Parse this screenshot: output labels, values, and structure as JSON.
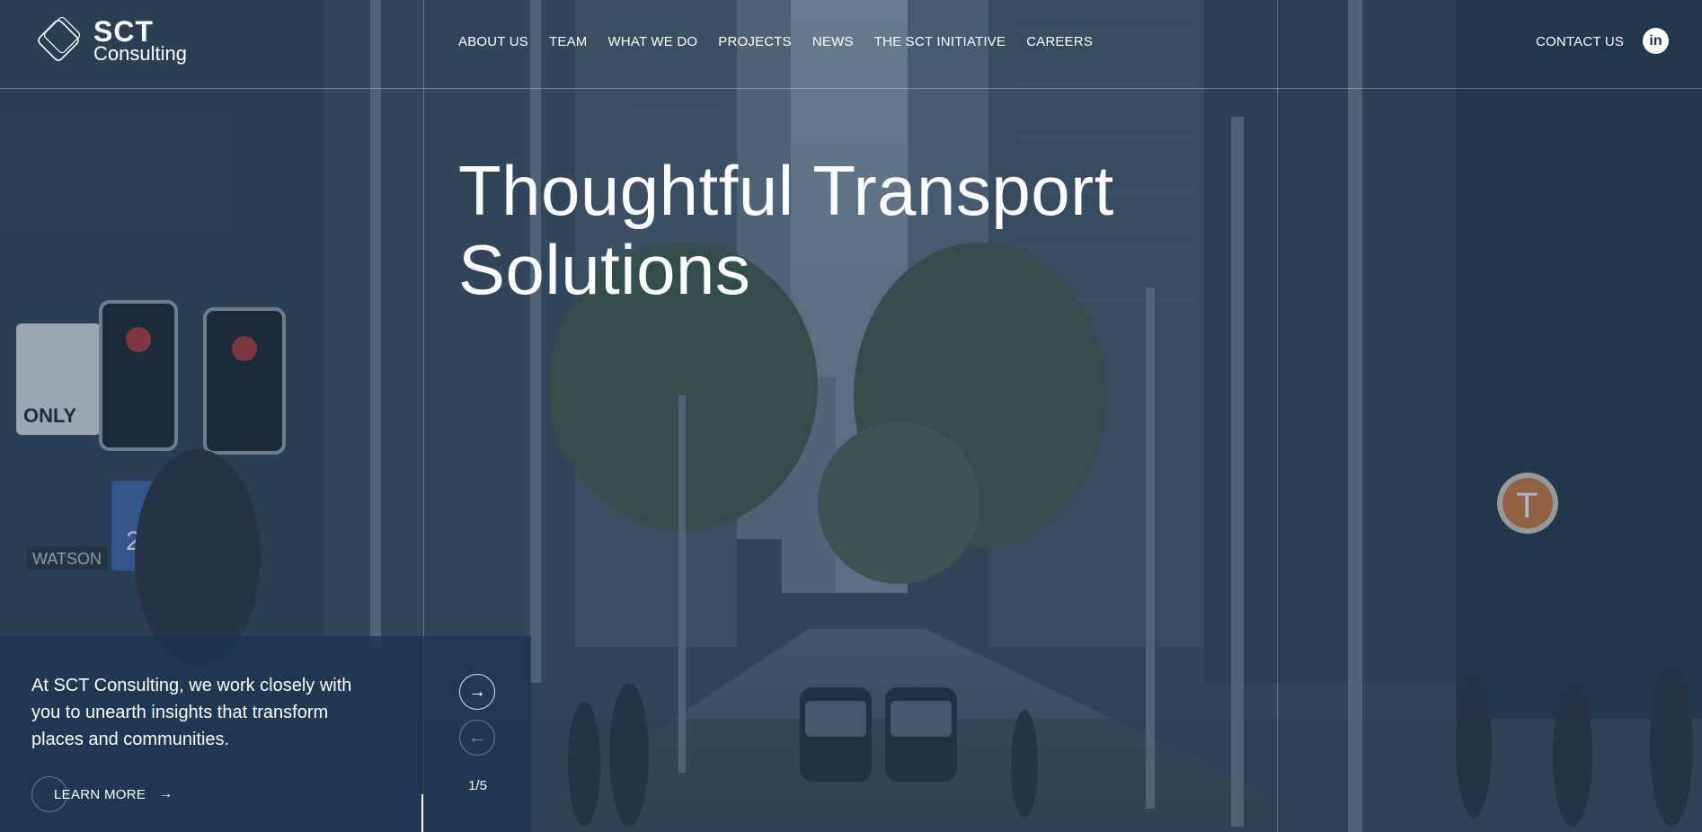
{
  "logo": {
    "name": "SCT",
    "sub": "Consulting"
  },
  "nav": {
    "items": [
      "ABOUT US",
      "TEAM",
      "WHAT WE DO",
      "PROJECTS",
      "NEWS",
      "THE SCT INITIATIVE",
      "CAREERS"
    ]
  },
  "header": {
    "contact_label": "CONTACT US",
    "linkedin_label": "in"
  },
  "hero": {
    "line1": "Thoughtful Transport",
    "line2": "Solutions"
  },
  "panel": {
    "blurb": "At SCT Consulting, we work closely with you to unearth insights that transform places and communities.",
    "learn_more": "LEARN MORE"
  },
  "slider": {
    "current": 1,
    "total": 5,
    "counter": "1/5"
  },
  "scene": {
    "sign_text": "ONLY",
    "speed_sign": "20",
    "tram_sign": "T",
    "street_sign": "WATSON"
  },
  "colors": {
    "overlay": "#1e344e",
    "panel": "#1b3452"
  }
}
